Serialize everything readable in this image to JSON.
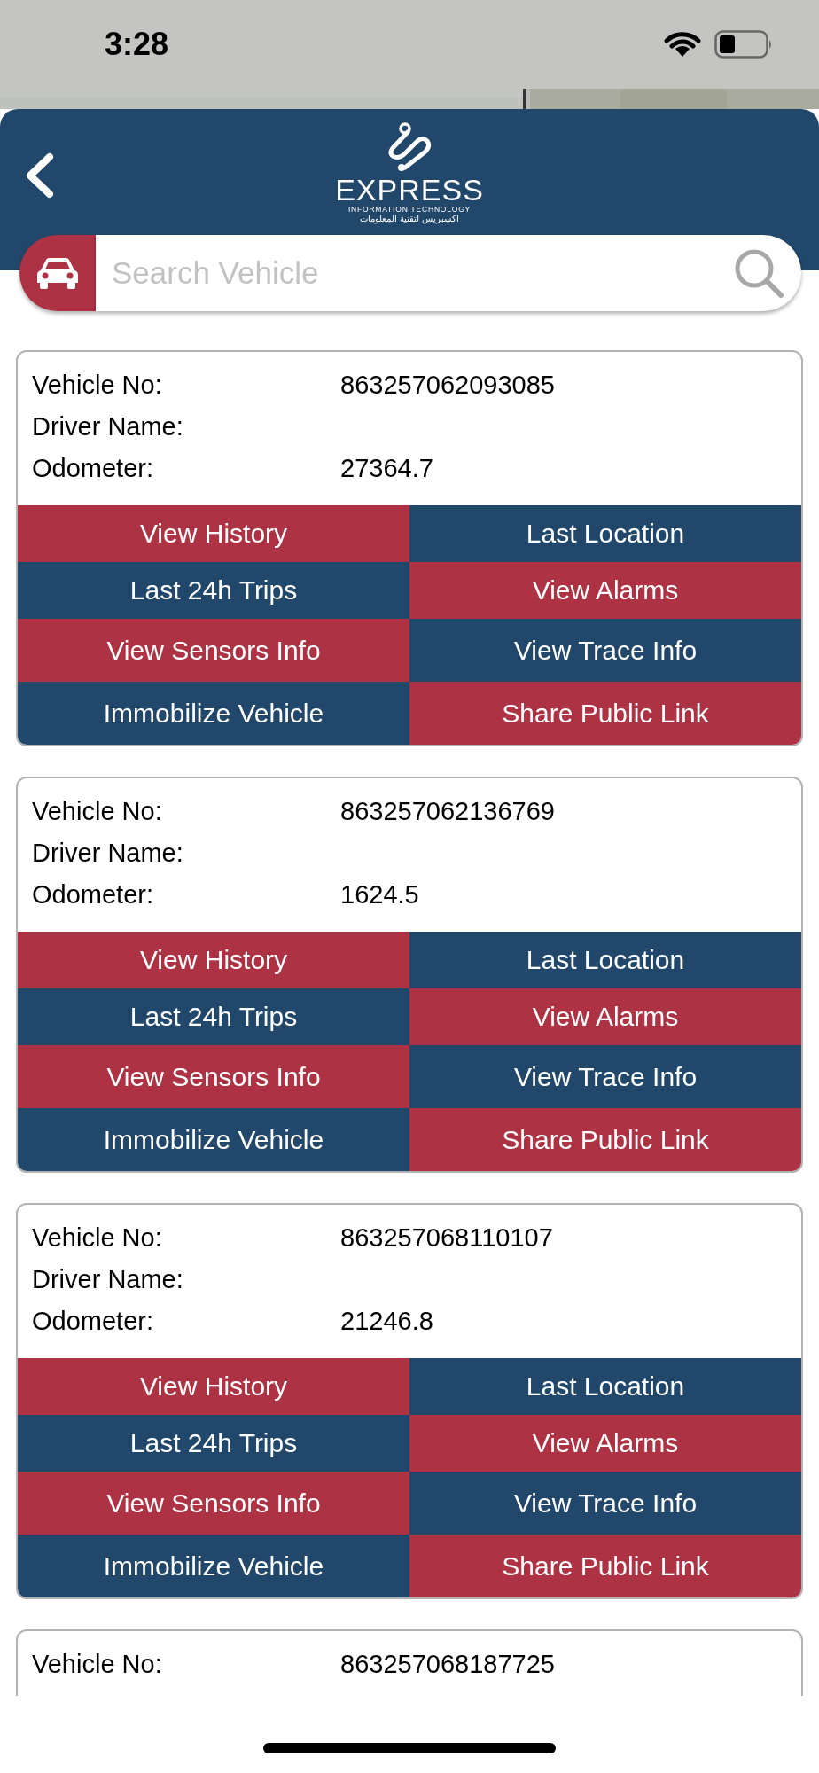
{
  "status_bar": {
    "time": "3:28"
  },
  "header": {
    "logo": {
      "title": "EXPRESS",
      "subtitle": "INFORMATION TECHNOLOGY",
      "arabic": "اكسبريس لتقنية المعلومات"
    }
  },
  "search": {
    "placeholder": "Search Vehicle"
  },
  "vehicles": [
    {
      "fields": [
        {
          "label": "Vehicle No:",
          "value": "863257062093085"
        },
        {
          "label": "Driver Name:"
        },
        {
          "label": "Odometer:",
          "value": "27364.7"
        }
      ],
      "actions": [
        {
          "label": "View History",
          "color": "#ad3244"
        },
        {
          "label": "Last Location",
          "color": "#21476a"
        },
        {
          "label": "Last 24h Trips",
          "color": "#21476a"
        },
        {
          "label": "View Alarms",
          "color": "#ad3244"
        },
        {
          "label": "View Sensors Info",
          "color": "#ad3244"
        },
        {
          "label": "View Trace Info",
          "color": "#21476a"
        },
        {
          "label": "Immobilize Vehicle",
          "color": "#21476a"
        },
        {
          "label": "Share Public Link",
          "color": "#ad3244"
        }
      ]
    },
    {
      "fields": [
        {
          "label": "Vehicle No:",
          "value": "863257062136769"
        },
        {
          "label": "Driver Name:"
        },
        {
          "label": "Odometer:",
          "value": "1624.5"
        }
      ],
      "actions": [
        {
          "label": "View History",
          "color": "#ad3244"
        },
        {
          "label": "Last Location",
          "color": "#21476a"
        },
        {
          "label": "Last 24h Trips",
          "color": "#21476a"
        },
        {
          "label": "View Alarms",
          "color": "#ad3244"
        },
        {
          "label": "View Sensors Info",
          "color": "#ad3244"
        },
        {
          "label": "View Trace Info",
          "color": "#21476a"
        },
        {
          "label": "Immobilize Vehicle",
          "color": "#21476a"
        },
        {
          "label": "Share Public Link",
          "color": "#ad3244"
        }
      ]
    },
    {
      "fields": [
        {
          "label": "Vehicle No:",
          "value": "863257068110107"
        },
        {
          "label": "Driver Name:"
        },
        {
          "label": "Odometer:",
          "value": "21246.8"
        }
      ],
      "actions": [
        {
          "label": "View History",
          "color": "#ad3244"
        },
        {
          "label": "Last Location",
          "color": "#21476a"
        },
        {
          "label": "Last 24h Trips",
          "color": "#21476a"
        },
        {
          "label": "View Alarms",
          "color": "#ad3244"
        },
        {
          "label": "View Sensors Info",
          "color": "#ad3244"
        },
        {
          "label": "View Trace Info",
          "color": "#21476a"
        },
        {
          "label": "Immobilize Vehicle",
          "color": "#21476a"
        },
        {
          "label": "Share Public Link",
          "color": "#ad3244"
        }
      ]
    },
    {
      "fields": [
        {
          "label": "Vehicle No:",
          "value": "863257068187725"
        }
      ]
    }
  ]
}
